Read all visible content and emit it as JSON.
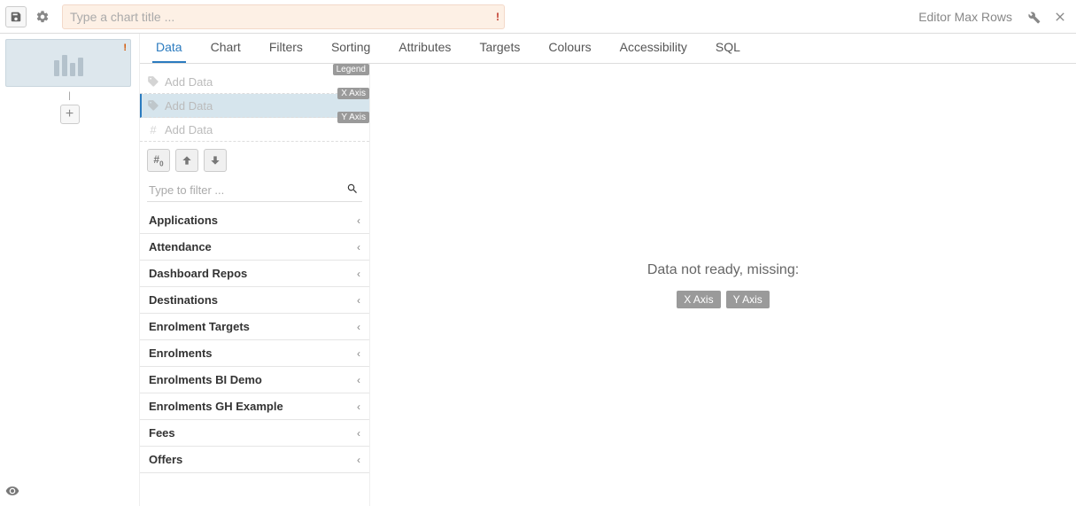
{
  "toolbar": {
    "title_placeholder": "Type a chart title ...",
    "rows_label": "Editor Max Rows"
  },
  "tabs": [
    {
      "label": "Data"
    },
    {
      "label": "Chart"
    },
    {
      "label": "Filters"
    },
    {
      "label": "Sorting"
    },
    {
      "label": "Attributes"
    },
    {
      "label": "Targets"
    },
    {
      "label": "Colours"
    },
    {
      "label": "Accessibility"
    },
    {
      "label": "SQL"
    }
  ],
  "dropzones": {
    "legend": {
      "badge": "Legend",
      "placeholder": "Add Data"
    },
    "xaxis": {
      "badge": "X Axis",
      "placeholder": "Add Data"
    },
    "yaxis": {
      "badge": "Y Axis",
      "placeholder": "Add Data"
    }
  },
  "filter_placeholder": "Type to filter ...",
  "categories": [
    {
      "name": "Applications"
    },
    {
      "name": "Attendance"
    },
    {
      "name": "Dashboard Repos"
    },
    {
      "name": "Destinations"
    },
    {
      "name": "Enrolment Targets"
    },
    {
      "name": "Enrolments"
    },
    {
      "name": "Enrolments BI Demo"
    },
    {
      "name": "Enrolments GH Example"
    },
    {
      "name": "Fees"
    },
    {
      "name": "Offers"
    }
  ],
  "canvas": {
    "message": "Data not ready, missing:",
    "missing": [
      "X Axis",
      "Y Axis"
    ]
  }
}
